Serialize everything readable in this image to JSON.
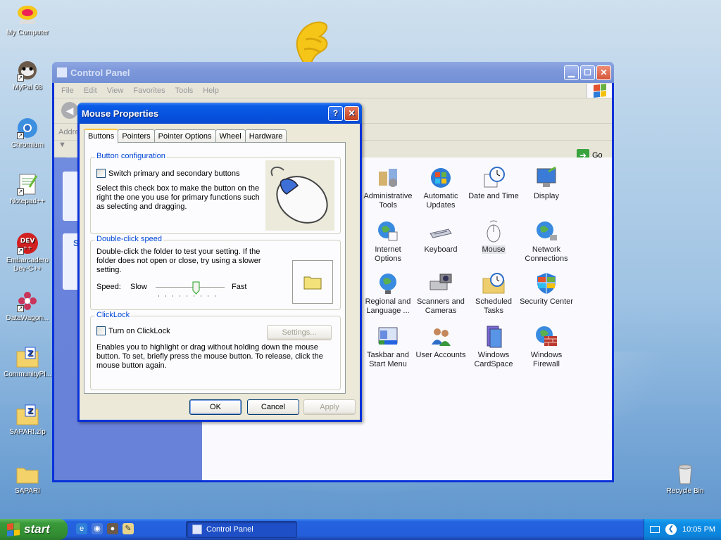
{
  "desktop": {
    "icons": [
      "My Computer",
      "MyPal 68",
      "Chromium",
      "Notepad++",
      "Embarcadero Dev-C++",
      "DataWagon...",
      "CommunityPl...",
      "SAPARI.zip",
      "SAPARI",
      "Recycle Bin"
    ]
  },
  "control_panel": {
    "title": "Control Panel",
    "menu": [
      "File",
      "Edit",
      "View",
      "Favorites",
      "Tools",
      "Help"
    ],
    "address_label": "Addre",
    "go_label": "Go",
    "items": [
      {
        "label": "Administrative Tools"
      },
      {
        "label": "Automatic Updates"
      },
      {
        "label": "Date and Time"
      },
      {
        "label": "Display"
      },
      {
        "label": "Internet Options"
      },
      {
        "label": "Keyboard"
      },
      {
        "label": "Mouse"
      },
      {
        "label": "Network Connections"
      },
      {
        "label": "Regional and Language ..."
      },
      {
        "label": "Scanners and Cameras"
      },
      {
        "label": "Scheduled Tasks"
      },
      {
        "label": "Security Center"
      },
      {
        "label": "Taskbar and Start Menu"
      },
      {
        "label": "User Accounts"
      },
      {
        "label": "Windows CardSpace"
      },
      {
        "label": "Windows Firewall"
      }
    ],
    "side_letter": "S"
  },
  "dialog": {
    "title": "Mouse Properties",
    "help_label": "?",
    "close_label": "✕",
    "tabs": [
      "Buttons",
      "Pointers",
      "Pointer Options",
      "Wheel",
      "Hardware"
    ],
    "button_config": {
      "group_label": "Button configuration",
      "checkbox_label": "Switch primary and secondary buttons",
      "description": "Select this check box to make the button on the right the one you use for primary functions such as selecting and dragging."
    },
    "double_click": {
      "group_label": "Double-click speed",
      "description": "Double-click the folder to test your setting. If the folder does not open or close, try using a slower setting.",
      "speed_label": "Speed:",
      "slow_label": "Slow",
      "fast_label": "Fast",
      "slider_value": 0.6
    },
    "clicklock": {
      "group_label": "ClickLock",
      "checkbox_label": "Turn on ClickLock",
      "settings_label": "Settings...",
      "description": "Enables you to highlight or drag without holding down the mouse button. To set, briefly press the mouse button. To release, click the mouse button again."
    },
    "ok_label": "OK",
    "cancel_label": "Cancel",
    "apply_label": "Apply"
  },
  "taskbar": {
    "start_label": "start",
    "task_label": "Control Panel",
    "clock": "10:05 PM"
  },
  "colors": {
    "accent": "#0550dc",
    "start_green": "#3a9a3a",
    "group_label": "#0046d5"
  }
}
